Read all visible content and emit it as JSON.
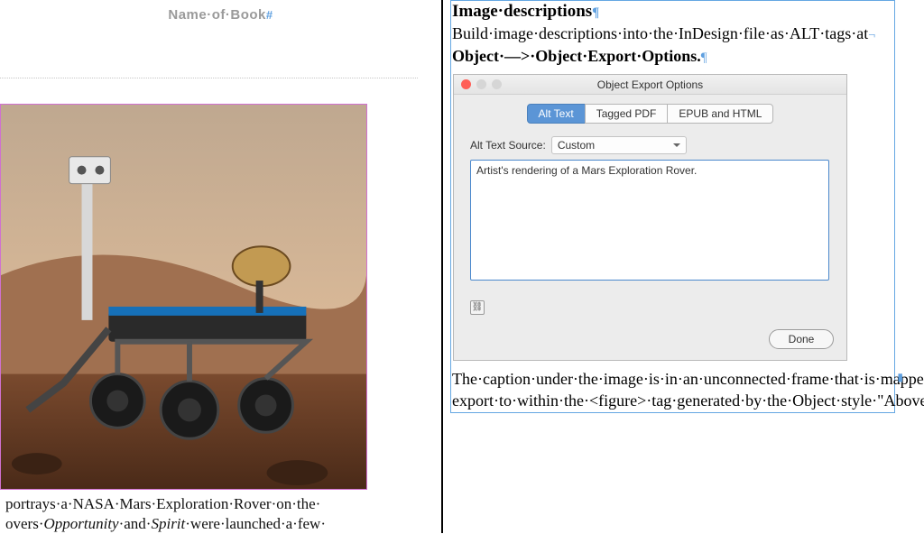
{
  "left": {
    "header": "Name·of·Book",
    "header_marker": "#",
    "caption_line1": "portrays·a·NASA·Mars·Exploration·Rover·on·the·",
    "caption_line2a": "overs·",
    "caption_em1": "Opportunity",
    "caption_line2b": "·and·",
    "caption_em2": "Spirit",
    "caption_line2c": "·were·launched·a·few·"
  },
  "right": {
    "heading": "Image·descriptions",
    "body_line1": "Build·image·descriptions·into·the·InDesign·file·as·ALT·tags·at",
    "body_line2_pre": "Object·—>·",
    "body_line2_bold": "Object·Export·Options.",
    "caption_text": "The·caption·under·the·image·is·in·an·unconnected·frame·that·is·mapped·to·<figcaption>·HTML.·It·will·have·to·be·moved·post-export·to·within·the·<figure>·tag·generated·by·the·Object·style·\"Above·line·centered\"·applied·to·the·image.",
    "caption_marker": "#"
  },
  "dialog": {
    "title": "Object Export Options",
    "tabs": {
      "t1": "Alt Text",
      "t2": "Tagged PDF",
      "t3": "EPUB and HTML"
    },
    "ats_label": "Alt Text Source:",
    "ats_value": "Custom",
    "textarea_value": "Artist's rendering of a Mars Exploration Rover.",
    "chain_glyph": "⛓",
    "done": "Done"
  },
  "chart_data": null
}
